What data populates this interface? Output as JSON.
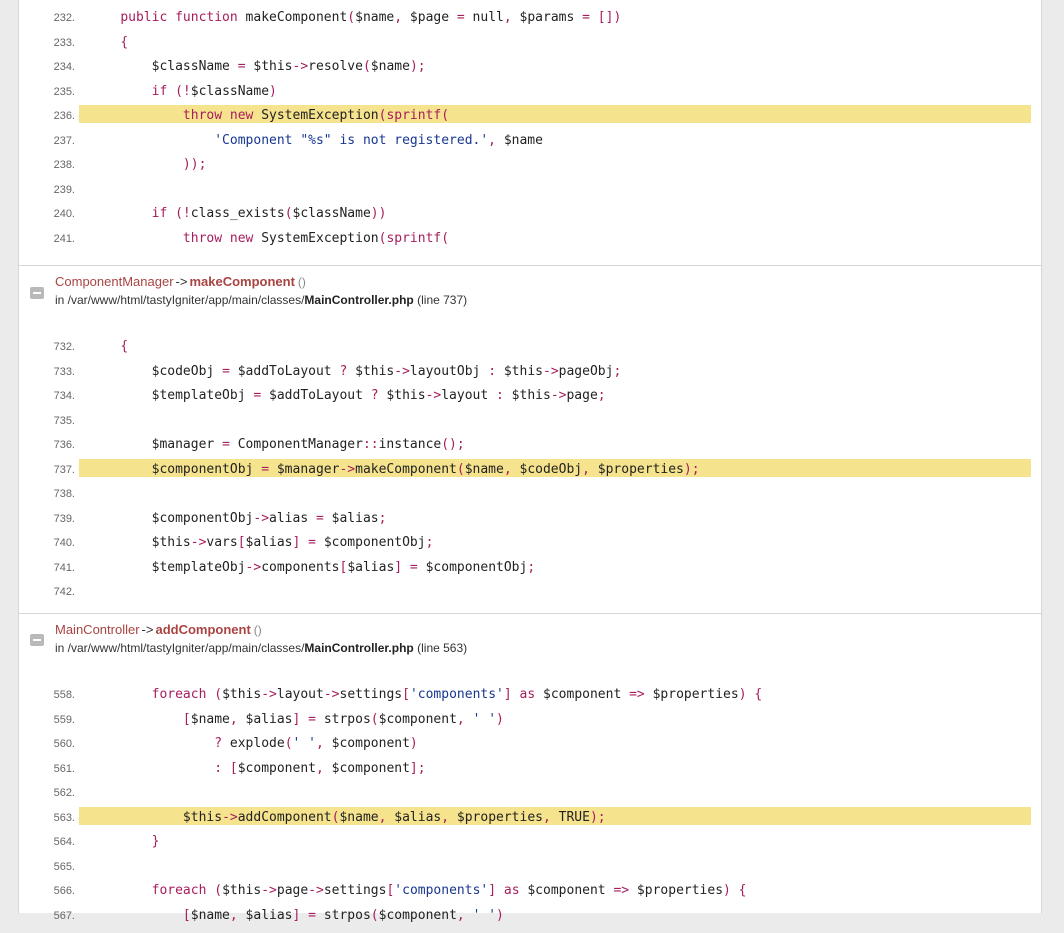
{
  "frames": [
    {
      "id": "frame1",
      "lines": [
        {
          "n": "232.",
          "hl": false,
          "code": "    <k>public function</k> makeComponent<o>(</o>$name<o>,</o> $page <o>=</o> null<o>,</o> $params <o>= [])</o>"
        },
        {
          "n": "233.",
          "hl": false,
          "code": "    <o>{</o>"
        },
        {
          "n": "234.",
          "hl": false,
          "code": "        $className <o>=</o> $this<o>-></o>resolve<o>(</o>$name<o>);</o>"
        },
        {
          "n": "235.",
          "hl": false,
          "code": "        <k>if</k> <o>(!</o>$className<o>)</o>"
        },
        {
          "n": "236.",
          "hl": true,
          "code": "            <k>throw new</k> SystemException<o>(</o><k>sprintf</k><o>(</o>"
        },
        {
          "n": "237.",
          "hl": false,
          "code": "                <s>'Component \"%s\" is not registered.'</s><o>,</o> $name"
        },
        {
          "n": "238.",
          "hl": false,
          "code": "            <o>));</o>"
        },
        {
          "n": "239.",
          "hl": false,
          "code": ""
        },
        {
          "n": "240.",
          "hl": false,
          "code": "        <k>if</k> <o>(!</o>class_exists<o>(</o>$className<o>))</o>"
        },
        {
          "n": "241.",
          "hl": false,
          "code": "            <k>throw new</k> SystemException<o>(</o><k>sprintf</k><o>(</o>"
        }
      ]
    },
    {
      "id": "frame2",
      "class_name": "ComponentManager",
      "arrow": "->",
      "function_name": "makeComponent",
      "parens": "()",
      "path_prefix": "in /var/www/html/tastyIgniter/app/main/classes/",
      "file_name": "MainController.php",
      "line_info": "(line 737)",
      "lines": [
        {
          "n": "732.",
          "hl": false,
          "code": "    <o>{</o>"
        },
        {
          "n": "733.",
          "hl": false,
          "code": "        $codeObj <o>=</o> $addToLayout <o>?</o> $this<o>-></o>layoutObj <o>:</o> $this<o>-></o>pageObj<o>;</o>"
        },
        {
          "n": "734.",
          "hl": false,
          "code": "        $templateObj <o>=</o> $addToLayout <o>?</o> $this<o>-></o>layout <o>:</o> $this<o>-></o>page<o>;</o>"
        },
        {
          "n": "735.",
          "hl": false,
          "code": ""
        },
        {
          "n": "736.",
          "hl": false,
          "code": "        $manager <o>=</o> ComponentManager<o>::</o>instance<o>();</o>"
        },
        {
          "n": "737.",
          "hl": true,
          "code": "        $componentObj <o>=</o> $manager<o>-></o>makeComponent<o>(</o>$name<o>,</o> $codeObj<o>,</o> $properties<o>);</o>"
        },
        {
          "n": "738.",
          "hl": false,
          "code": ""
        },
        {
          "n": "739.",
          "hl": false,
          "code": "        $componentObj<o>-></o>alias <o>=</o> $alias<o>;</o>"
        },
        {
          "n": "740.",
          "hl": false,
          "code": "        $this<o>-></o>vars<o>[</o>$alias<o>] =</o> $componentObj<o>;</o>"
        },
        {
          "n": "741.",
          "hl": false,
          "code": "        $templateObj<o>-></o>components<o>[</o>$alias<o>] =</o> $componentObj<o>;</o>"
        },
        {
          "n": "742.",
          "hl": false,
          "code": ""
        }
      ]
    },
    {
      "id": "frame3",
      "class_name": "MainController",
      "arrow": "->",
      "function_name": "addComponent",
      "parens": "()",
      "path_prefix": "in /var/www/html/tastyIgniter/app/main/classes/",
      "file_name": "MainController.php",
      "line_info": "(line 563)",
      "lines": [
        {
          "n": "558.",
          "hl": false,
          "code": "        <k>foreach</k> <o>(</o>$this<o>-></o>layout<o>-></o>settings<o>[</o><s>'components'</s><o>]</o> <k>as</k> $component <o>=></o> $properties<o>) {</o>"
        },
        {
          "n": "559.",
          "hl": false,
          "code": "            <o>[</o>$name<o>,</o> $alias<o>] =</o> strpos<o>(</o>$component<o>,</o> <s>' '</s><o>)</o>"
        },
        {
          "n": "560.",
          "hl": false,
          "code": "                <o>?</o> explode<o>(</o><s>' '</s><o>,</o> $component<o>)</o>"
        },
        {
          "n": "561.",
          "hl": false,
          "code": "                <o>: [</o>$component<o>,</o> $component<o>];</o>"
        },
        {
          "n": "562.",
          "hl": false,
          "code": ""
        },
        {
          "n": "563.",
          "hl": true,
          "code": "            $this<o>-></o>addComponent<o>(</o>$name<o>,</o> $alias<o>,</o> $properties<o>,</o> TRUE<o>);</o>"
        },
        {
          "n": "564.",
          "hl": false,
          "code": "        <o>}</o>"
        },
        {
          "n": "565.",
          "hl": false,
          "code": ""
        },
        {
          "n": "566.",
          "hl": false,
          "code": "        <k>foreach</k> <o>(</o>$this<o>-></o>page<o>-></o>settings<o>[</o><s>'components'</s><o>]</o> <k>as</k> $component <o>=></o> $properties<o>) {</o>"
        },
        {
          "n": "567.",
          "hl": false,
          "code": "            <o>[</o>$name<o>,</o> $alias<o>] =</o> strpos<o>(</o>$component<o>,</o> <s>' '</s><o>)</o>"
        }
      ]
    }
  ],
  "colors": {
    "keyword": "#a71d5d",
    "string": "#183691",
    "highlight": "#f6e38d",
    "class_name": "#a94442"
  }
}
